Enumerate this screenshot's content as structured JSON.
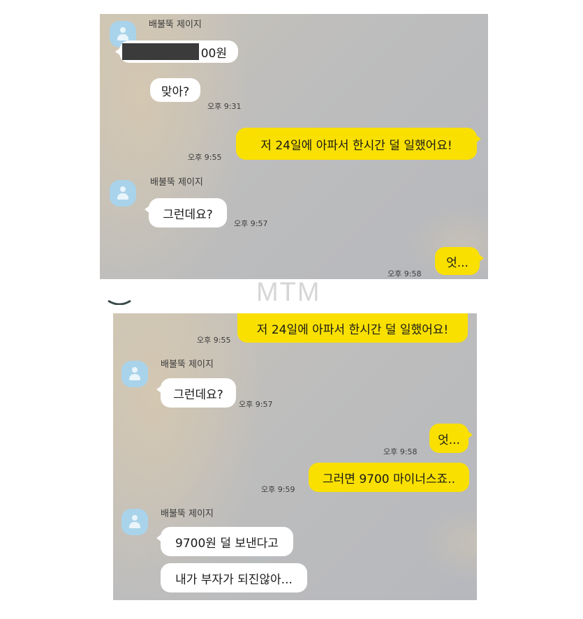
{
  "watermark": "MTM",
  "top": {
    "sender1": "배불뚝 제이지",
    "msg_amount_suffix": "00원",
    "msg_right": "맞아?",
    "time_931": "오후 9:31",
    "msg_sick": "저 24일에 아파서 한시간 덜 일했어요!",
    "time_955": "오후 9:55",
    "sender2": "배불뚝 제이지",
    "msg_so": "그런데요?",
    "time_957": "오후 9:57",
    "msg_eh": "엇...",
    "time_958": "오후 9:58"
  },
  "bottom": {
    "msg_sick": "저 24일에 아파서 한시간 덜 일했어요!",
    "time_955": "오후 9:55",
    "sender1": "배불뚝 제이지",
    "msg_so": "그런데요?",
    "time_957": "오후 9:57",
    "msg_eh": "엇...",
    "time_958": "오후 9:58",
    "msg_minus": "그러면 9700 마이너스죠..",
    "time_959": "오후 9:59",
    "sender2": "배불뚝 제이지",
    "msg_less": "9700원 덜 보낸다고",
    "msg_rich": "내가 부자가 되진않아..."
  },
  "colors": {
    "outgoing_bubble": "#f9e000",
    "incoming_bubble": "#ffffff",
    "avatar": "#a9d3ea"
  }
}
